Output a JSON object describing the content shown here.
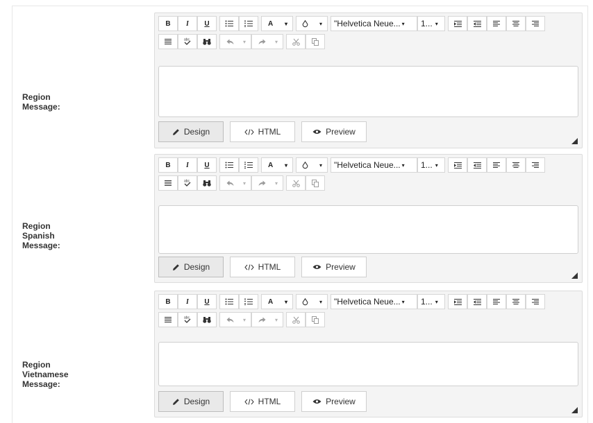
{
  "toolbar": {
    "bold": "B",
    "italic": "I",
    "underline": "U",
    "font_color": "A",
    "font_name": "\"Helvetica Neue...",
    "font_size": "1...",
    "caret": "▾"
  },
  "modes": {
    "design": "Design",
    "html": "HTML",
    "preview": "Preview"
  },
  "editors": [
    {
      "label": "Region Message:"
    },
    {
      "label": "Region Spanish Message:"
    },
    {
      "label": "Region Vietnamese Message:"
    }
  ],
  "colors": {
    "toolbar_bg": "#f4f4f4",
    "border": "#dcdcdc",
    "active_mode": "#e9e9e9"
  }
}
